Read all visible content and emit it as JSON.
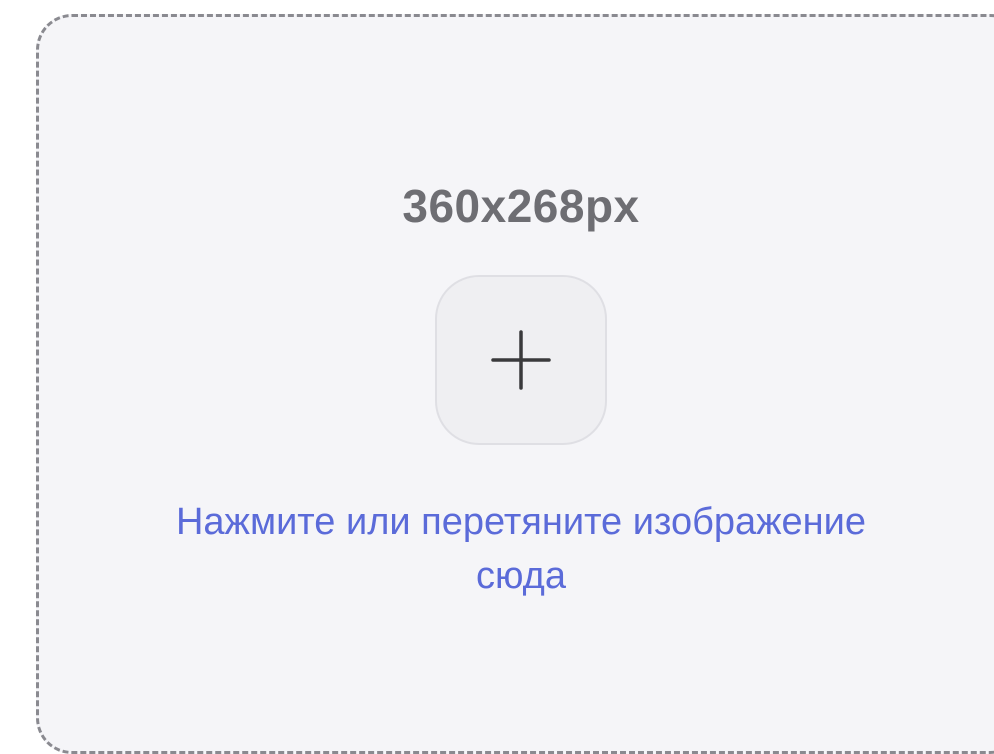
{
  "upload": {
    "size_text": "360x268px",
    "add_icon": "plus-icon",
    "hint_line1": "Нажмите или перетяните изображение",
    "hint_line2": "сюда"
  },
  "colors": {
    "hint": "#5b6bd9",
    "size_text": "#6e6e73",
    "dropzone_bg": "#f5f5f8",
    "dropzone_border": "#8a8a90",
    "button_bg": "#efeff2"
  }
}
